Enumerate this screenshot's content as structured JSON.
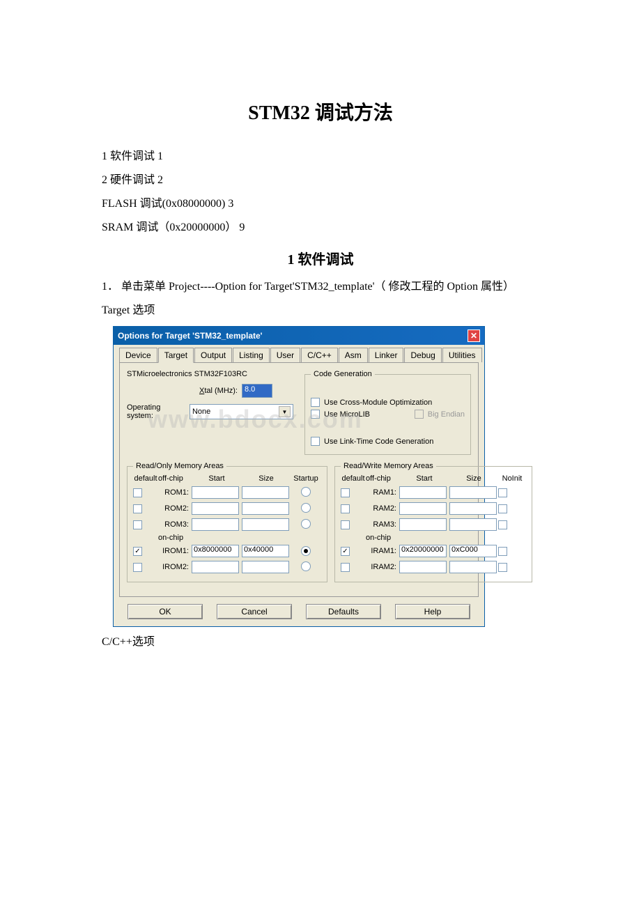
{
  "doc": {
    "title": "STM32 调试方法",
    "toc": {
      "l1": "1 软件调试 1",
      "l2": "2 硬件调试 2",
      "l3": "FLASH 调试(0x08000000) 3",
      "l4": "SRAM 调试（0x20000000） 9"
    },
    "section1_heading": "1 软件调试",
    "step1": "1．  单击菜单 Project----Option for Target'STM32_template'（ 修改工程的 Option 属性）",
    "target_label": "Target 选项",
    "ccpp_label": "C/C++选项"
  },
  "dialog": {
    "title": "Options for Target 'STM32_template'",
    "tabs": [
      "Device",
      "Target",
      "Output",
      "Listing",
      "User",
      "C/C++",
      "Asm",
      "Linker",
      "Debug",
      "Utilities"
    ],
    "device_name": "STMicroelectronics STM32F103RC",
    "xtal_label": "Xtal (MHz):",
    "xtal_value": "8.0",
    "os_label": "Operating system:",
    "os_value": "None",
    "codegen_legend": "Code Generation",
    "codegen": {
      "cross": "Use Cross-Module Optimization",
      "microlib": "Use MicroLIB",
      "bigendian": "Big Endian",
      "linktime": "Use Link-Time Code Generation"
    },
    "watermark": "www.bdocx.com",
    "rom_legend": "Read/Only Memory Areas",
    "ram_legend": "Read/Write Memory Areas",
    "headers": {
      "default": "default",
      "offchip": "off-chip",
      "start": "Start",
      "size": "Size",
      "startup": "Startup",
      "noinit": "NoInit"
    },
    "rom_rows": {
      "r1": "ROM1:",
      "r2": "ROM2:",
      "r3": "ROM3:",
      "onchip": "on-chip",
      "i1": "IROM1:",
      "i1_start": "0x8000000",
      "i1_size": "0x40000",
      "i2": "IROM2:"
    },
    "ram_rows": {
      "r1": "RAM1:",
      "r2": "RAM2:",
      "r3": "RAM3:",
      "onchip": "on-chip",
      "i1": "IRAM1:",
      "i1_start": "0x20000000",
      "i1_size": "0xC000",
      "i2": "IRAM2:"
    },
    "buttons": {
      "ok": "OK",
      "cancel": "Cancel",
      "defaults": "Defaults",
      "help": "Help"
    }
  }
}
